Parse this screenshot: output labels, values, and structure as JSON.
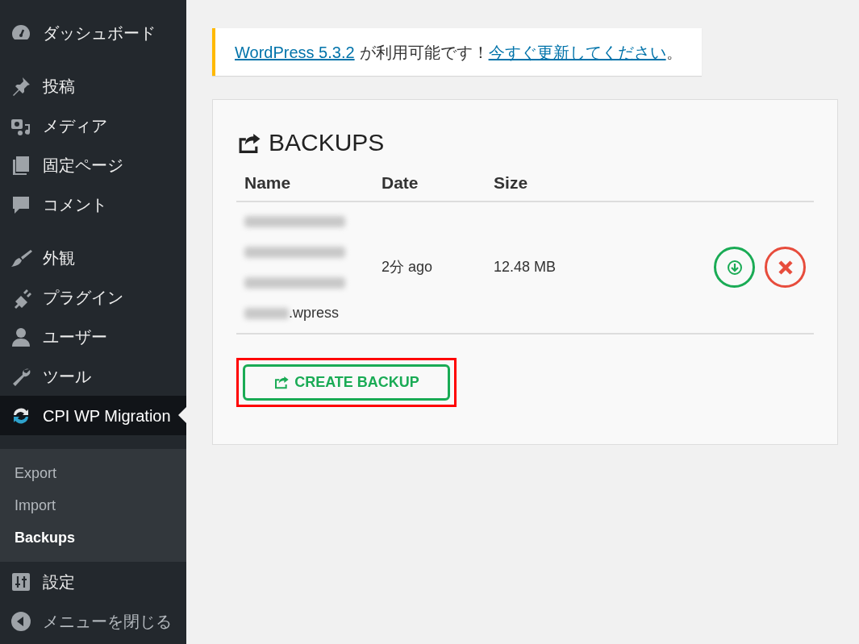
{
  "sidebar": {
    "groups": [
      {
        "items": [
          {
            "label": "ダッシュボード",
            "selected": false
          }
        ]
      },
      {
        "items": [
          {
            "label": "投稿",
            "selected": false
          },
          {
            "label": "メディア",
            "selected": false
          },
          {
            "label": "固定ページ",
            "selected": false
          },
          {
            "label": "コメント",
            "selected": false
          }
        ]
      },
      {
        "items": [
          {
            "label": "外観",
            "selected": false
          },
          {
            "label": "プラグイン",
            "selected": false
          },
          {
            "label": "ユーザー",
            "selected": false
          },
          {
            "label": "ツール",
            "selected": false
          },
          {
            "label": "CPI WP Migration",
            "selected": true,
            "children": [
              {
                "label": "Export",
                "selected": false
              },
              {
                "label": "Import",
                "selected": false
              },
              {
                "label": "Backups",
                "selected": true
              }
            ]
          },
          {
            "label": "設定",
            "selected": false
          },
          {
            "label": "メニューを閉じる",
            "selected": false,
            "kind": "collapse"
          }
        ]
      }
    ]
  },
  "notice": {
    "link": "WordPress 5.3.2",
    "text": "が利用可能です！",
    "action_link": "今すぐ更新してください",
    "end": "。"
  },
  "card": {
    "title": "BACKUPS",
    "table": {
      "columns": [
        "Name",
        "Date",
        "Size"
      ],
      "rows": [
        {
          "name_redacted": true,
          "name": ".wpress",
          "date": "2分 ago",
          "size": "12.48 MB"
        }
      ]
    },
    "create_button": {
      "label": "CREATE BACKUP",
      "highlighted": true
    }
  }
}
